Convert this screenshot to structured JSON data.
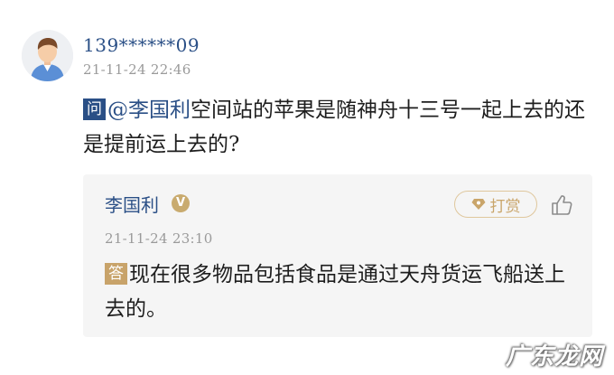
{
  "question_post": {
    "user_name": "139******09",
    "timestamp": "21-11-24 22:46",
    "badge": "问",
    "mention": "@李国利",
    "text": "空间站的苹果是随神舟十三号一起上去的还是提前运上去的?"
  },
  "answer_post": {
    "author": "李国利",
    "verified_badge": "V",
    "tip_label": "打赏",
    "timestamp": "21-11-24 23:10",
    "badge": "答",
    "text": "现在很多物品包括食品是通过天舟货运飞船送上去的。"
  },
  "watermark": "广东龙网",
  "icons": {
    "avatar": "default-user-avatar",
    "tip": "diamond-icon",
    "like": "thumbs-up-icon"
  },
  "colors": {
    "link_blue": "#2a4f86",
    "gold": "#c9a56a",
    "muted_gray": "#9a9a9a",
    "card_bg": "#f5f5f5"
  }
}
